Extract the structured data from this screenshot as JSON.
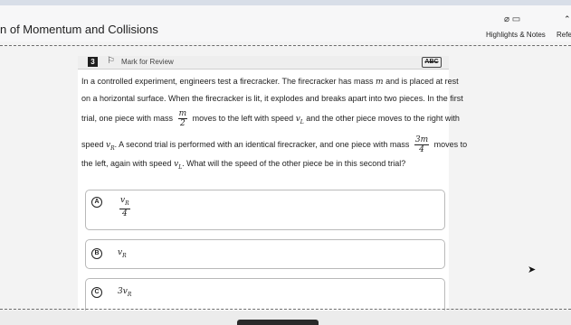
{
  "header": {
    "title": "n of Momentum and Collisions",
    "highlights_label": "Highlights & Notes",
    "highlights_icons": "⌀ ▭",
    "reference_label": "Refe",
    "reference_icon": "⌃"
  },
  "question": {
    "number": "3",
    "mark_label": "Mark for Review",
    "strike_label": "ABC",
    "line1": "In a controlled experiment, engineers test a firecracker. The firecracker has mass",
    "line1_var": "m",
    "line1_end": "and is placed at rest",
    "line2": "on a horizontal surface. When the firecracker is lit, it explodes and breaks apart into two pieces. In the first",
    "line3_start": "trial, one piece with mass",
    "frac1_num": "m",
    "frac1_den": "2",
    "line3_mid": "moves to the left with speed",
    "line3_var": "v",
    "line3_sub": "L",
    "line3_end": "and the other piece moves to the right with",
    "line4_start": "speed",
    "line4_var": "v",
    "line4_sub": "R",
    "line4_mid": ". A second trial is performed with an identical firecracker, and one piece with mass",
    "frac2_num": "3m",
    "frac2_den": "4",
    "line4_end": "moves to",
    "line5_start": "the left, again with speed",
    "line5_var": "v",
    "line5_sub": "L",
    "line5_end": ". What will the speed of the other piece be in this second trial?"
  },
  "choices": [
    {
      "letter": "A",
      "num": "v",
      "num_sub": "R",
      "den": "4"
    },
    {
      "letter": "B",
      "value": "v",
      "value_sub": "R"
    },
    {
      "letter": "C",
      "value": "3v",
      "value_sub": "R"
    }
  ]
}
